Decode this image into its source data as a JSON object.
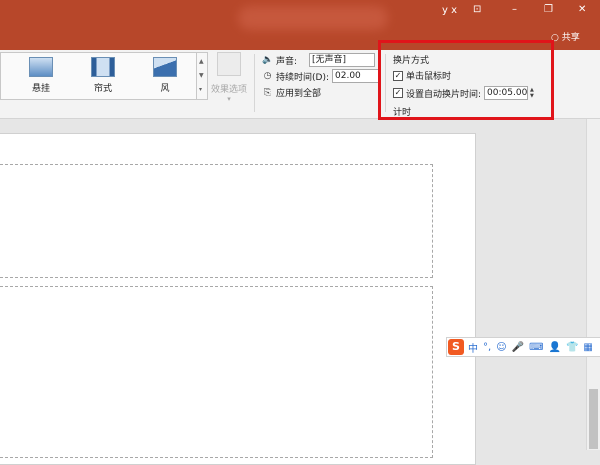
{
  "titlebar": {
    "user": "y x",
    "restore_btn": "⊡",
    "minimize_btn": "–",
    "maximize_btn": "❐",
    "close_btn": "✕",
    "share_icon": "○",
    "share": "共享"
  },
  "transitions": {
    "items": [
      {
        "label": "悬挂",
        "icon": "hang-transition-icon"
      },
      {
        "label": "帘式",
        "icon": "curtain-transition-icon"
      },
      {
        "label": "风",
        "icon": "wind-transition-icon"
      }
    ],
    "scroll_up": "▲",
    "scroll_down": "▼",
    "more": "▾",
    "effect_options": "效果选项",
    "effect_arrow": "▾"
  },
  "timing": {
    "sound_icon": "🔈",
    "sound_label": "声音:",
    "sound_value": "[无声音]",
    "duration_icon": "◷",
    "duration_label": "持续时间(D):",
    "duration_value": "02.00",
    "apply_icon": "⎘",
    "apply_all": "应用到全部",
    "advance_title": "换片方式",
    "on_click": "单击鼠标时",
    "after_time": "设置自动换片时间:",
    "after_time_value": "00:05.00",
    "check": "✓",
    "spin_up": "▲",
    "spin_down": "▼",
    "group_label": "计时"
  },
  "ime": {
    "logo": "S",
    "icons": [
      "中",
      "°,",
      "☺",
      "🎤",
      "⌨",
      "👤",
      "👕",
      "▦"
    ]
  },
  "colors": {
    "titlebar": "#b7472a",
    "highlight": "#e0141a"
  }
}
